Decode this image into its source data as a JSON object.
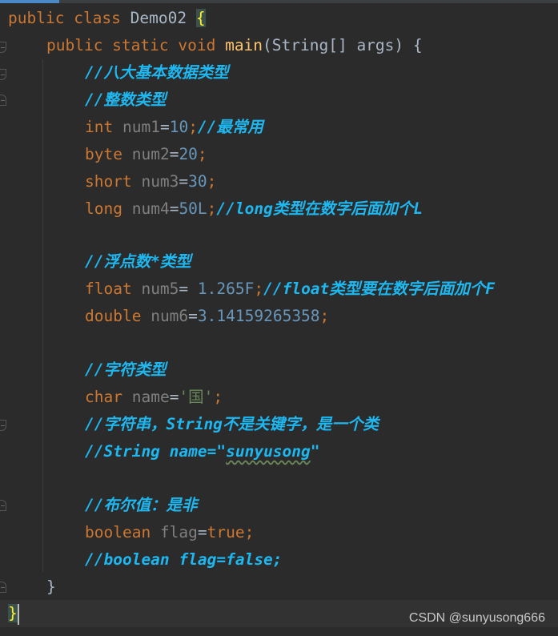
{
  "editor": {
    "colors": {
      "keyword": "#cc7832",
      "class_name": "#a9b7c6",
      "variable": "#7f7f7f",
      "number": "#6897bb",
      "comment": "#1eb7f0",
      "string": "#6a8759",
      "method": "#ffc66d",
      "brace_match": "#ffef28",
      "background": "#2b2b2b"
    },
    "lines": {
      "l1": {
        "public": "public",
        "class": "class",
        "name": "Demo02",
        "brace": "{"
      },
      "l2": {
        "mods": "public static void",
        "method": "main",
        "params": "(String[] args) {"
      },
      "l3": {
        "comment": "//八大基本数据类型"
      },
      "l4": {
        "comment": "//整数类型"
      },
      "l5": {
        "type": "int",
        "var": "num1",
        "eq": "=",
        "val": "10",
        "semi": ";",
        "comment": "//最常用"
      },
      "l6": {
        "type": "byte",
        "var": "num2",
        "eq": "=",
        "val": "20",
        "semi": ";"
      },
      "l7": {
        "type": "short",
        "var": "num3",
        "eq": "=",
        "val": "30",
        "semi": ";"
      },
      "l8": {
        "type": "long",
        "var": "num4",
        "eq": "=",
        "val": "50L",
        "semi": ";",
        "comment": "//long类型在数字后面加个L"
      },
      "l9": {
        "comment": "//浮点数*类型"
      },
      "l10": {
        "type": "float",
        "var": "num5",
        "eq": "= ",
        "val": "1.265F",
        "semi": ";",
        "comment": "//float类型要在数字后面加个F"
      },
      "l11": {
        "type": "double",
        "var": "num6",
        "eq": "=",
        "val": "3.14159265358",
        "semi": ";"
      },
      "l12": {
        "comment": "//字符类型"
      },
      "l13": {
        "type": "char",
        "var": "name",
        "eq": "=",
        "val": "'国'",
        "semi": ";"
      },
      "l14": {
        "comment": "//字符串，String不是关键字，是一个类"
      },
      "l15": {
        "comment_a": "//String name=\"",
        "comment_b": "sunyusong",
        "comment_c": "\""
      },
      "l16": {
        "comment": "//布尔值：是非"
      },
      "l17": {
        "type": "boolean",
        "var": "flag",
        "eq": "=",
        "val": "true",
        "semi": ";"
      },
      "l18": {
        "comment": "//boolean flag=false;"
      },
      "l19": {
        "brace": "}"
      },
      "l20": {
        "brace": "}"
      }
    }
  },
  "watermark": "CSDN @sunyusong666"
}
